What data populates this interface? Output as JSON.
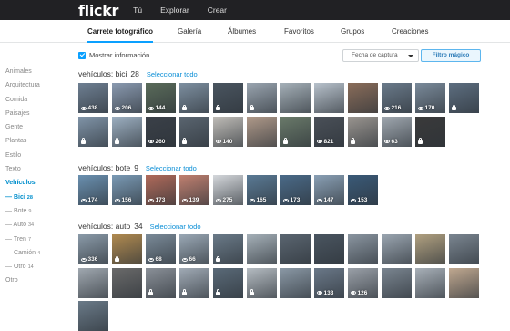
{
  "topbar": {
    "logo": "flickr",
    "nav": [
      "Tú",
      "Explorar",
      "Crear"
    ]
  },
  "subnav": {
    "tabs": [
      {
        "label": "Carrete fotográfico",
        "active": true
      },
      {
        "label": "Galería",
        "active": false
      },
      {
        "label": "Álbumes",
        "active": false
      },
      {
        "label": "Favoritos",
        "active": false
      },
      {
        "label": "Grupos",
        "active": false
      },
      {
        "label": "Creaciones",
        "active": false
      }
    ]
  },
  "sidebar": {
    "items": [
      {
        "label": "Animales",
        "type": "plain"
      },
      {
        "label": "Arquitectura",
        "type": "plain"
      },
      {
        "label": "Comida",
        "type": "plain"
      },
      {
        "label": "Paisajes",
        "type": "plain"
      },
      {
        "label": "Gente",
        "type": "plain"
      },
      {
        "label": "Plantas",
        "type": "plain"
      },
      {
        "label": "Estilo",
        "type": "plain"
      },
      {
        "label": "Texto",
        "type": "plain"
      },
      {
        "label": "Vehículos",
        "type": "bold"
      },
      {
        "label": "— Bici",
        "count": "28",
        "type": "active-sub"
      },
      {
        "label": "— Bote",
        "count": "9",
        "type": "sub"
      },
      {
        "label": "— Auto",
        "count": "34",
        "type": "sub"
      },
      {
        "label": "— Tren",
        "count": "7",
        "type": "sub"
      },
      {
        "label": "— Camión",
        "count": "4",
        "type": "sub"
      },
      {
        "label": "— Otro",
        "count": "14",
        "type": "sub"
      },
      {
        "label": "Otro",
        "type": "plain"
      }
    ]
  },
  "toolbar": {
    "show_info_label": "Mostrar información",
    "show_info_checked": true,
    "sort_select": "Fecha de captura",
    "magic_filter": "Filtro mágico"
  },
  "sections": [
    {
      "title": "vehículos: bici",
      "count": "28",
      "select_all": "Seleccionar todo",
      "tiles": [
        {
          "c": "#6e7f92",
          "v": "438"
        },
        {
          "c": "#8a9ab0",
          "v": "206"
        },
        {
          "c": "#5a6b5a",
          "v": "144"
        },
        {
          "c": "#7d8fa0",
          "v": "lock"
        },
        {
          "c": "#4a5560",
          "v": "lock"
        },
        {
          "c": "#9aa5b0",
          "v": "lock"
        },
        {
          "c": "#a5b0b8",
          "v": ""
        },
        {
          "c": "#b8c2cc",
          "v": ""
        },
        {
          "c": "#8a6d5a",
          "v": ""
        },
        {
          "c": "#6a7a8a",
          "v": "216"
        },
        {
          "c": "#7a8a9a",
          "v": "170"
        },
        {
          "c": "#5d6e80",
          "v": "lock"
        },
        {
          "c": "#8094a8",
          "v": "lock"
        },
        {
          "c": "#9db0c2",
          "v": "lock"
        },
        {
          "c": "#3a4048",
          "v": "260"
        },
        {
          "c": "#5a6570",
          "v": "lock"
        },
        {
          "c": "#c0bdb8",
          "v": "140"
        },
        {
          "c": "#b09a8a",
          "v": ""
        },
        {
          "c": "#6a7a6a",
          "v": "lock"
        },
        {
          "c": "#4a5058",
          "v": "821"
        },
        {
          "c": "#9a9590",
          "v": "lock"
        },
        {
          "c": "#a0a8b0",
          "v": "63"
        },
        {
          "c": "#3a3a3a",
          "v": "lock"
        }
      ]
    },
    {
      "title": "vehículos: bote",
      "count": "9",
      "select_all": "Seleccionar todo",
      "tiles": [
        {
          "c": "#6a90b0",
          "v": "174"
        },
        {
          "c": "#7a9ab5",
          "v": "156"
        },
        {
          "c": "#b06a5a",
          "v": "173"
        },
        {
          "c": "#c08070",
          "v": "139"
        },
        {
          "c": "#d5d8dc",
          "v": "275"
        },
        {
          "c": "#5a7a95",
          "v": "165"
        },
        {
          "c": "#4a6a88",
          "v": "173"
        },
        {
          "c": "#8aa0b5",
          "v": "147"
        },
        {
          "c": "#3a5a78",
          "v": "153"
        }
      ]
    },
    {
      "title": "vehículos: auto",
      "count": "34",
      "select_all": "Seleccionar todo",
      "tiles": [
        {
          "c": "#8a9aa8",
          "v": "336"
        },
        {
          "c": "#b08a50",
          "v": "lock"
        },
        {
          "c": "#7a8a98",
          "v": "68"
        },
        {
          "c": "#9aa8b5",
          "v": "66"
        },
        {
          "c": "#6a7a88",
          "v": "lock"
        },
        {
          "c": "#a5b0b8",
          "v": ""
        },
        {
          "c": "#5a6570",
          "v": ""
        },
        {
          "c": "#4a5560",
          "v": ""
        },
        {
          "c": "#8a95a0",
          "v": ""
        },
        {
          "c": "#9aa5b0",
          "v": ""
        },
        {
          "c": "#b0a080",
          "v": ""
        },
        {
          "c": "#7a8590",
          "v": ""
        },
        {
          "c": "#a0a8b0",
          "v": ""
        },
        {
          "c": "#6a6a6a",
          "v": ""
        },
        {
          "c": "#8a9098",
          "v": "lock"
        },
        {
          "c": "#a0aab5",
          "v": "lock"
        },
        {
          "c": "#5a6a78",
          "v": "lock"
        },
        {
          "c": "#b5bcc2",
          "v": "lock"
        },
        {
          "c": "#8a98a5",
          "v": ""
        },
        {
          "c": "#6a7888",
          "v": "133"
        },
        {
          "c": "#9aa0a8",
          "v": "126"
        },
        {
          "c": "#7a8590",
          "v": ""
        },
        {
          "c": "#a8b0b8",
          "v": ""
        },
        {
          "c": "#c0a890",
          "v": ""
        },
        {
          "c": "#6a7a88",
          "v": ""
        }
      ]
    }
  ]
}
